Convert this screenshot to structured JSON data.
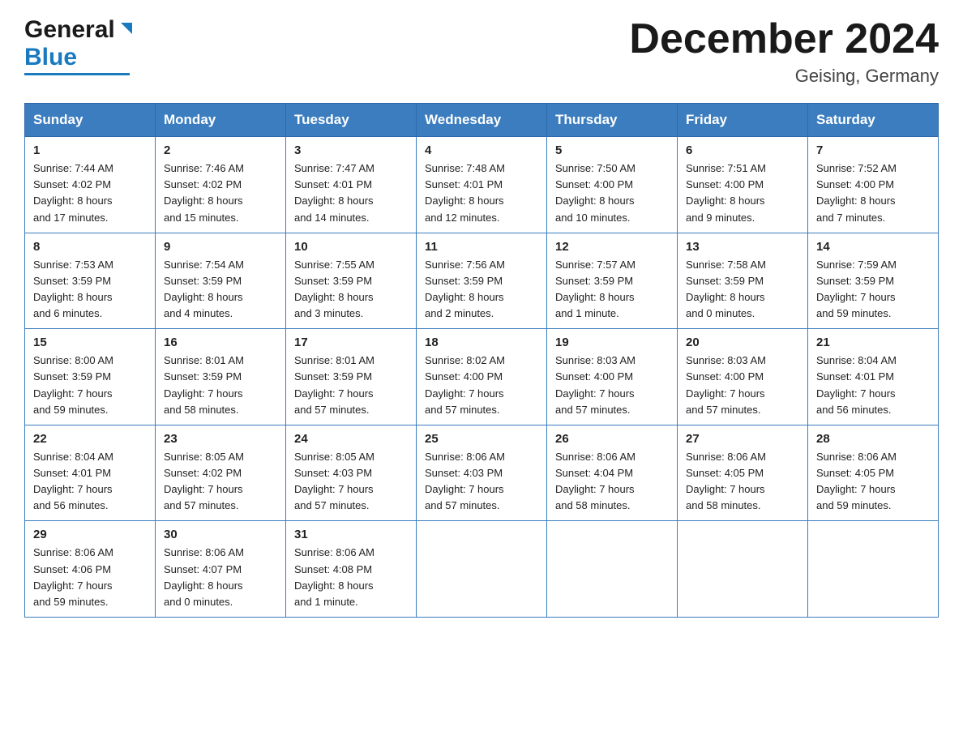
{
  "header": {
    "logo_general": "General",
    "logo_blue": "Blue",
    "month_title": "December 2024",
    "location": "Geising, Germany"
  },
  "days_of_week": [
    "Sunday",
    "Monday",
    "Tuesday",
    "Wednesday",
    "Thursday",
    "Friday",
    "Saturday"
  ],
  "weeks": [
    [
      {
        "day": "1",
        "sunrise": "7:44 AM",
        "sunset": "4:02 PM",
        "daylight": "8 hours and 17 minutes."
      },
      {
        "day": "2",
        "sunrise": "7:46 AM",
        "sunset": "4:02 PM",
        "daylight": "8 hours and 15 minutes."
      },
      {
        "day": "3",
        "sunrise": "7:47 AM",
        "sunset": "4:01 PM",
        "daylight": "8 hours and 14 minutes."
      },
      {
        "day": "4",
        "sunrise": "7:48 AM",
        "sunset": "4:01 PM",
        "daylight": "8 hours and 12 minutes."
      },
      {
        "day": "5",
        "sunrise": "7:50 AM",
        "sunset": "4:00 PM",
        "daylight": "8 hours and 10 minutes."
      },
      {
        "day": "6",
        "sunrise": "7:51 AM",
        "sunset": "4:00 PM",
        "daylight": "8 hours and 9 minutes."
      },
      {
        "day": "7",
        "sunrise": "7:52 AM",
        "sunset": "4:00 PM",
        "daylight": "8 hours and 7 minutes."
      }
    ],
    [
      {
        "day": "8",
        "sunrise": "7:53 AM",
        "sunset": "3:59 PM",
        "daylight": "8 hours and 6 minutes."
      },
      {
        "day": "9",
        "sunrise": "7:54 AM",
        "sunset": "3:59 PM",
        "daylight": "8 hours and 4 minutes."
      },
      {
        "day": "10",
        "sunrise": "7:55 AM",
        "sunset": "3:59 PM",
        "daylight": "8 hours and 3 minutes."
      },
      {
        "day": "11",
        "sunrise": "7:56 AM",
        "sunset": "3:59 PM",
        "daylight": "8 hours and 2 minutes."
      },
      {
        "day": "12",
        "sunrise": "7:57 AM",
        "sunset": "3:59 PM",
        "daylight": "8 hours and 1 minute."
      },
      {
        "day": "13",
        "sunrise": "7:58 AM",
        "sunset": "3:59 PM",
        "daylight": "8 hours and 0 minutes."
      },
      {
        "day": "14",
        "sunrise": "7:59 AM",
        "sunset": "3:59 PM",
        "daylight": "7 hours and 59 minutes."
      }
    ],
    [
      {
        "day": "15",
        "sunrise": "8:00 AM",
        "sunset": "3:59 PM",
        "daylight": "7 hours and 59 minutes."
      },
      {
        "day": "16",
        "sunrise": "8:01 AM",
        "sunset": "3:59 PM",
        "daylight": "7 hours and 58 minutes."
      },
      {
        "day": "17",
        "sunrise": "8:01 AM",
        "sunset": "3:59 PM",
        "daylight": "7 hours and 57 minutes."
      },
      {
        "day": "18",
        "sunrise": "8:02 AM",
        "sunset": "4:00 PM",
        "daylight": "7 hours and 57 minutes."
      },
      {
        "day": "19",
        "sunrise": "8:03 AM",
        "sunset": "4:00 PM",
        "daylight": "7 hours and 57 minutes."
      },
      {
        "day": "20",
        "sunrise": "8:03 AM",
        "sunset": "4:00 PM",
        "daylight": "7 hours and 57 minutes."
      },
      {
        "day": "21",
        "sunrise": "8:04 AM",
        "sunset": "4:01 PM",
        "daylight": "7 hours and 56 minutes."
      }
    ],
    [
      {
        "day": "22",
        "sunrise": "8:04 AM",
        "sunset": "4:01 PM",
        "daylight": "7 hours and 56 minutes."
      },
      {
        "day": "23",
        "sunrise": "8:05 AM",
        "sunset": "4:02 PM",
        "daylight": "7 hours and 57 minutes."
      },
      {
        "day": "24",
        "sunrise": "8:05 AM",
        "sunset": "4:03 PM",
        "daylight": "7 hours and 57 minutes."
      },
      {
        "day": "25",
        "sunrise": "8:06 AM",
        "sunset": "4:03 PM",
        "daylight": "7 hours and 57 minutes."
      },
      {
        "day": "26",
        "sunrise": "8:06 AM",
        "sunset": "4:04 PM",
        "daylight": "7 hours and 58 minutes."
      },
      {
        "day": "27",
        "sunrise": "8:06 AM",
        "sunset": "4:05 PM",
        "daylight": "7 hours and 58 minutes."
      },
      {
        "day": "28",
        "sunrise": "8:06 AM",
        "sunset": "4:05 PM",
        "daylight": "7 hours and 59 minutes."
      }
    ],
    [
      {
        "day": "29",
        "sunrise": "8:06 AM",
        "sunset": "4:06 PM",
        "daylight": "7 hours and 59 minutes."
      },
      {
        "day": "30",
        "sunrise": "8:06 AM",
        "sunset": "4:07 PM",
        "daylight": "8 hours and 0 minutes."
      },
      {
        "day": "31",
        "sunrise": "8:06 AM",
        "sunset": "4:08 PM",
        "daylight": "8 hours and 1 minute."
      },
      null,
      null,
      null,
      null
    ]
  ],
  "labels": {
    "sunrise": "Sunrise:",
    "sunset": "Sunset:",
    "daylight": "Daylight:"
  }
}
